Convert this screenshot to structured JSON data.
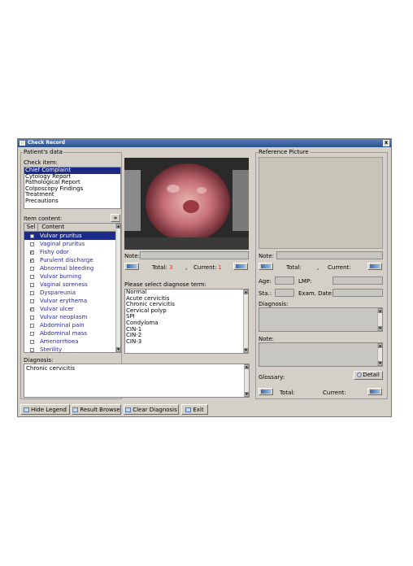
{
  "window": {
    "title": "Check Record",
    "close": "x"
  },
  "patient": {
    "group_label": "Patient's data",
    "check_item_label": "Check item:",
    "check_items": [
      "Chief Complaint",
      "Cytology Report",
      "Pathological Report",
      "Colposcopy Findings",
      "Treatment",
      "Precautions"
    ],
    "item_content_label": "Item content:",
    "expand_btn": "»",
    "table_headers": [
      "Sel",
      "Content"
    ],
    "rows": [
      {
        "checked": false,
        "label": "Vulvar pruritus",
        "selected": true
      },
      {
        "checked": false,
        "label": "Vaginal pruritus"
      },
      {
        "checked": true,
        "label": "Fishy odor"
      },
      {
        "checked": true,
        "label": "Purulent discharge"
      },
      {
        "checked": false,
        "label": "Abnormal bleeding"
      },
      {
        "checked": false,
        "label": "Vulvar burning"
      },
      {
        "checked": false,
        "label": "Vaginal soreness"
      },
      {
        "checked": false,
        "label": "Dyspareunia"
      },
      {
        "checked": false,
        "label": "Vulvar erythema"
      },
      {
        "checked": true,
        "label": "Vulvar ulcer"
      },
      {
        "checked": false,
        "label": "Vulvar neoplasm"
      },
      {
        "checked": false,
        "label": "Abdominal pain"
      },
      {
        "checked": false,
        "label": "Abdominal mass"
      },
      {
        "checked": false,
        "label": "Amenorrhoea"
      },
      {
        "checked": false,
        "label": "Sterility"
      }
    ],
    "diagnosis_label": "Diagnosis:",
    "diagnosis_value": "Chronic cervicitis"
  },
  "image_panel": {
    "note_label": "Note:",
    "total_label": "Total:",
    "total_value": "3",
    "current_label": "Current:",
    "current_value": "1",
    "diagnose_prompt": "Please select diagnose term:",
    "terms": [
      "Normal",
      "Acute cervicitis",
      "Chronic cervicitis",
      "Cervical polyp",
      "SPI",
      "Condyloma",
      "CIN-1",
      "CIN-2",
      "CIN-3"
    ]
  },
  "reference": {
    "group_label": "Reference Picture",
    "note_label": "Note:",
    "total_label": "Total:",
    "current_label": "Current:",
    "age_label": "Age:",
    "lmp_label": "LMP:",
    "sta_label": "Sta.:",
    "exam_date_label": "Exam. Date:",
    "diagnosis_label": "Diagnosis:",
    "note2_label": "Note:",
    "glossary_label": "Glossary:",
    "detail_btn": "Detail",
    "bottom_total_label": "Total:",
    "bottom_current_label": "Current:"
  },
  "footer": {
    "hide_legend": "Hide Legend",
    "result_browse": "Result Browse",
    "clear_diagnosis": "Clear Diagnosis",
    "exit": "Exit"
  },
  "colors": {
    "selection": "#1c2a8a",
    "count_red": "#c0392b",
    "titlebar": "#2a4f8f",
    "window_bg": "#d4d0c8"
  }
}
